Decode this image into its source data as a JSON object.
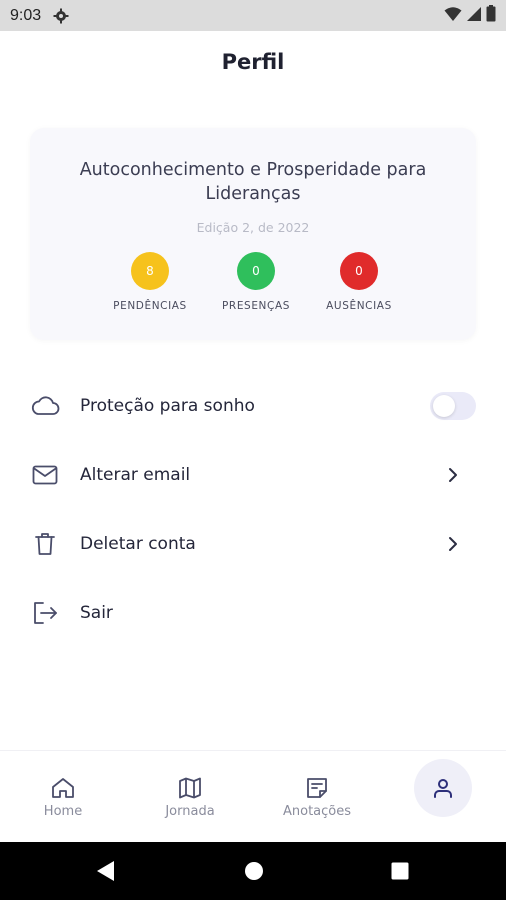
{
  "status_bar": {
    "time": "9:03",
    "icons": [
      "gear-icon",
      "wifi-icon",
      "signal-icon",
      "battery-icon"
    ]
  },
  "header": {
    "title": "Perfil"
  },
  "course_card": {
    "title": "Autoconhecimento e Prosperidade para Lideranças",
    "edition": "Edição 2, de 2022",
    "stats": [
      {
        "count": "8",
        "label": "PENDÊNCIAS",
        "color": "#f6c21c"
      },
      {
        "count": "0",
        "label": "PRESENÇAS",
        "color": "#2fbf5c"
      },
      {
        "count": "0",
        "label": "AUSÊNCIAS",
        "color": "#e02b2b"
      }
    ]
  },
  "menu": {
    "items": [
      {
        "label": "Proteção para sonho",
        "icon": "cloud-icon",
        "control": "toggle",
        "toggle_on": false
      },
      {
        "label": "Alterar email",
        "icon": "mail-icon",
        "control": "chevron-right-icon"
      },
      {
        "label": "Deletar conta",
        "icon": "trash-icon",
        "control": "chevron-right-icon"
      },
      {
        "label": "Sair",
        "icon": "logout-icon",
        "control": "none"
      }
    ]
  },
  "bottom_nav": {
    "items": [
      {
        "label": "Home",
        "icon": "home-icon",
        "active": false
      },
      {
        "label": "Jornada",
        "icon": "map-icon",
        "active": false
      },
      {
        "label": "Anotações",
        "icon": "notes-icon",
        "active": false
      },
      {
        "label": "",
        "icon": "profile-icon",
        "active": true
      }
    ]
  },
  "colors": {
    "accent": "#2d2f7a",
    "text_primary": "#24263a",
    "card_bg": "#f8f8fc"
  }
}
